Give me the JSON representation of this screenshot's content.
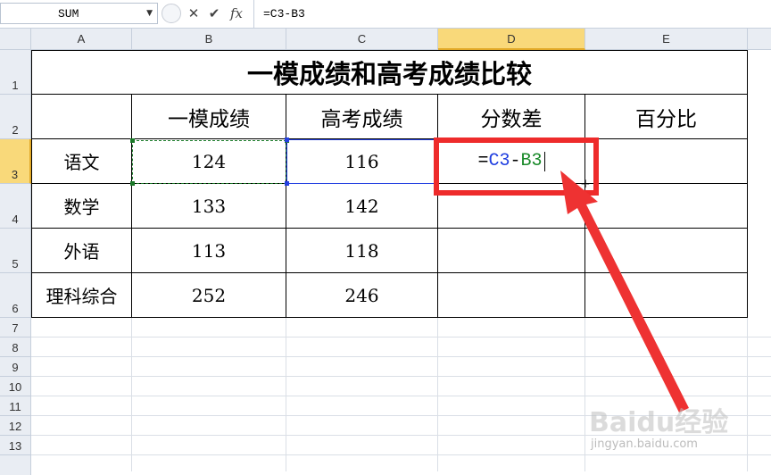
{
  "formula_bar": {
    "name_box": "SUM",
    "formula": "=C3-B3",
    "cancel_icon": "✕",
    "enter_icon": "✔",
    "fx_icon": "fx"
  },
  "columns": [
    "A",
    "B",
    "C",
    "D",
    "E"
  ],
  "rows": [
    "1",
    "2",
    "3",
    "4",
    "5",
    "6",
    "7",
    "8",
    "9",
    "10",
    "11",
    "12",
    "13"
  ],
  "sheet": {
    "title": "一模成绩和高考成绩比较",
    "headers": [
      "一模成绩",
      "高考成绩",
      "分数差",
      "百分比"
    ],
    "subjects": [
      "语文",
      "数学",
      "外语",
      "理科综合"
    ],
    "mock_scores": [
      "124",
      "133",
      "113",
      "252"
    ],
    "gaokao_scores": [
      "116",
      "142",
      "118",
      "246"
    ],
    "editing": {
      "eq": "=",
      "ref1": "C3",
      "op": "-",
      "ref2": "B3"
    }
  },
  "annotation": {
    "color": "#ee2b2b"
  },
  "watermark": {
    "logo": "Baidu经验",
    "url": "jingyan.baidu.com"
  }
}
